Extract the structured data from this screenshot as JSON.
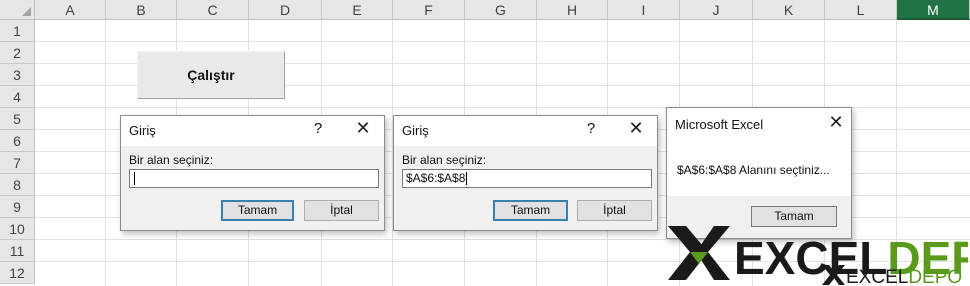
{
  "spreadsheet": {
    "columns": [
      "A",
      "B",
      "C",
      "D",
      "E",
      "F",
      "G",
      "H",
      "I",
      "J",
      "K",
      "L",
      "M"
    ],
    "selected_column": "M",
    "rows": [
      "1",
      "2",
      "3",
      "4",
      "5",
      "6",
      "7",
      "8",
      "9",
      "10",
      "11",
      "12"
    ]
  },
  "run_button": {
    "label": "Çalıştır"
  },
  "dialog1": {
    "title": "Giriş",
    "help": "?",
    "close": "✕",
    "prompt": "Bir alan seçiniz:",
    "input_value": "",
    "ok": "Tamam",
    "cancel": "İptal"
  },
  "dialog2": {
    "title": "Giriş",
    "help": "?",
    "close": "✕",
    "prompt": "Bir alan seçiniz:",
    "input_value": "$A$6:$A$8",
    "ok": "Tamam",
    "cancel": "İptal"
  },
  "msgbox": {
    "title": "Microsoft Excel",
    "close": "✕",
    "message": "$A$6:$A$8 Alanını seçtiniz...",
    "ok": "Tamam"
  },
  "watermark": {
    "large": "EXCELDEPO",
    "small": "EXCELDEPO"
  },
  "colors": {
    "selected_header": "#217346",
    "logo_green": "#5a9a1a",
    "logo_dark": "#1a1a1a"
  }
}
